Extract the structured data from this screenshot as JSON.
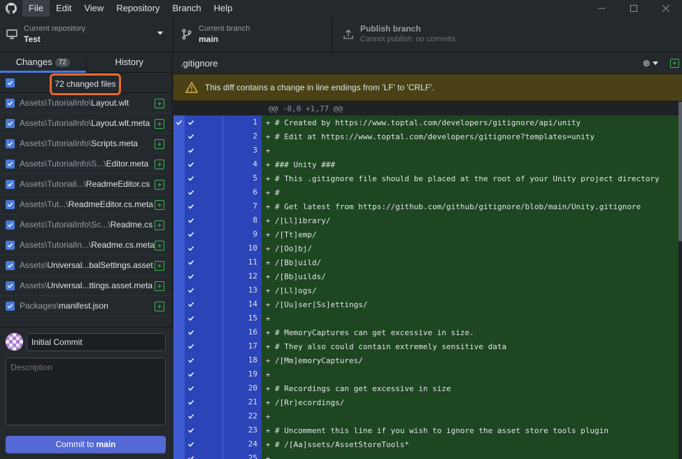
{
  "menu": {
    "items": [
      "File",
      "Edit",
      "View",
      "Repository",
      "Branch",
      "Help"
    ]
  },
  "toolbar": {
    "repo_label": "Current repository",
    "repo_value": "Test",
    "branch_label": "Current branch",
    "branch_value": "main",
    "publish_label": "Publish branch",
    "publish_sub": "Cannot publish: no commits"
  },
  "sidebar": {
    "tab_changes": "Changes",
    "tab_changes_count": "72",
    "tab_history": "History",
    "changed_files": "72 changed files",
    "files": [
      {
        "dir": "Assets\\TutorialInfo\\",
        "name": "Layout.wlt"
      },
      {
        "dir": "Assets\\TutorialInfo\\",
        "name": "Layout.wlt.meta"
      },
      {
        "dir": "Assets\\TutorialInfo\\",
        "name": "Scripts.meta"
      },
      {
        "dir": "Assets\\TutorialInfo\\S...\\",
        "name": "Editor.meta"
      },
      {
        "dir": "Assets\\Tutoriall...\\",
        "name": "ReadmeEditor.cs"
      },
      {
        "dir": "Assets\\Tut...\\",
        "name": "ReadmeEditor.cs.meta"
      },
      {
        "dir": "Assets\\TutorialInfo\\Sc...\\",
        "name": "Readme.cs"
      },
      {
        "dir": "Assets\\TutorialIn...\\",
        "name": "Readme.cs.meta"
      },
      {
        "dir": "Assets\\",
        "name": "Universal...balSettings.asset"
      },
      {
        "dir": "Assets\\",
        "name": "Universal...ttings.asset.meta"
      },
      {
        "dir": "Packages\\",
        "name": "manifest.json"
      }
    ],
    "commit_summary": "Initial Commit",
    "description_placeholder": "Description",
    "commit_prefix": "Commit to ",
    "commit_branch": "main"
  },
  "diff": {
    "filename": ".gitignore",
    "warning": "This diff contains a change in line endings from 'LF' to 'CRLF'.",
    "hunk": "@@ -0,0 +1,77 @@",
    "lines": [
      {
        "n": "1",
        "text": "# Created by https://www.toptal.com/developers/gitignore/api/unity"
      },
      {
        "n": "2",
        "text": "# Edit at https://www.toptal.com/developers/gitignore?templates=unity"
      },
      {
        "n": "3",
        "text": ""
      },
      {
        "n": "4",
        "text": "### Unity ###"
      },
      {
        "n": "5",
        "text": "# This .gitignore file should be placed at the root of your Unity project directory"
      },
      {
        "n": "6",
        "text": "#"
      },
      {
        "n": "7",
        "text": "# Get latest from https://github.com/github/gitignore/blob/main/Unity.gitignore"
      },
      {
        "n": "8",
        "text": "/[Ll]ibrary/"
      },
      {
        "n": "9",
        "text": "/[Tt]emp/"
      },
      {
        "n": "10",
        "text": "/[Oo]bj/"
      },
      {
        "n": "11",
        "text": "/[Bb]uild/"
      },
      {
        "n": "12",
        "text": "/[Bb]uilds/"
      },
      {
        "n": "13",
        "text": "/[Ll]ogs/"
      },
      {
        "n": "14",
        "text": "/[Uu]ser[Ss]ettings/"
      },
      {
        "n": "15",
        "text": ""
      },
      {
        "n": "16",
        "text": "# MemoryCaptures can get excessive in size."
      },
      {
        "n": "17",
        "text": "# They also could contain extremely sensitive data"
      },
      {
        "n": "18",
        "text": "/[Mm]emoryCaptures/"
      },
      {
        "n": "19",
        "text": ""
      },
      {
        "n": "20",
        "text": "# Recordings can get excessive in size"
      },
      {
        "n": "21",
        "text": "/[Rr]ecordings/"
      },
      {
        "n": "22",
        "text": ""
      },
      {
        "n": "23",
        "text": "# Uncomment this line if you wish to ignore the asset store tools plugin"
      },
      {
        "n": "24",
        "text": "# /[Aa]ssets/AssetStoreTools*"
      },
      {
        "n": "25",
        "text": ""
      }
    ]
  },
  "colors": {
    "accent": "#4a7adb",
    "highlight": "#ec6a2c",
    "added": "#1e4621",
    "gutter": "#2b44b8"
  }
}
